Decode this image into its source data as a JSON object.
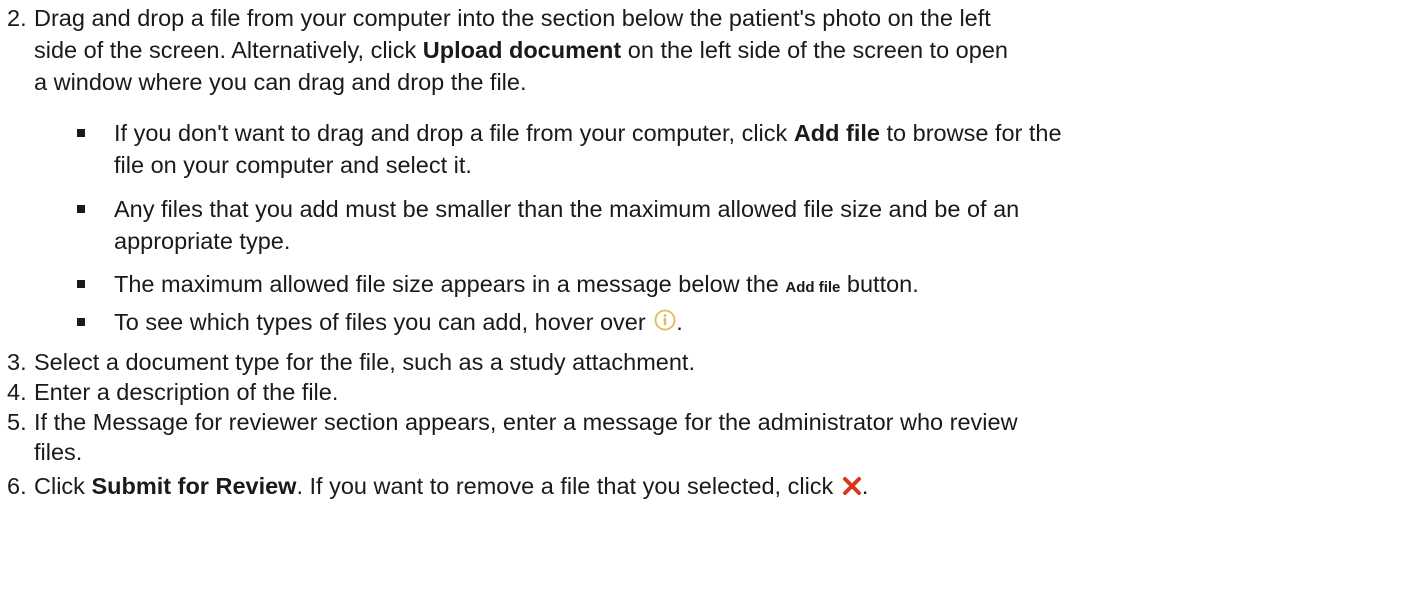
{
  "steps": {
    "s2": {
      "number": "2.",
      "line1": "Drag and drop a file from your computer into the section below the patient's photo on the left",
      "line2_a": "side of the screen. Alternatively, click ",
      "line2_bold": "Upload document",
      "line2_b": " on the left side of the screen to open",
      "line3": "a window where you can drag and drop the file."
    },
    "s3": {
      "number": "3.",
      "text": "Select a document type for the file, such as a study attachment."
    },
    "s4": {
      "number": "4.",
      "text": "Enter a description of the file."
    },
    "s5": {
      "number": "5.",
      "line1": "If the Message for reviewer section appears, enter a message for the administrator who review",
      "line2": "files."
    },
    "s6": {
      "number": "6.",
      "text_a": "Click ",
      "text_bold": "Submit for Review",
      "text_b": ". If you want to remove a file that you selected, click ",
      "text_end": "."
    }
  },
  "bullets": {
    "b1": {
      "line1_a": "If you don't want to drag and drop a file from your computer, click ",
      "line1_bold": "Add file",
      "line1_b": " to browse for the",
      "line2": "file on your computer and select it."
    },
    "b2": {
      "line1": "Any files that you add must be smaller than the maximum allowed file size and be of an",
      "line2": "appropriate type."
    },
    "b3": {
      "text_a": "The maximum allowed file size appears in a message below the ",
      "text_bold": "Add file",
      "text_b": " button."
    },
    "b4": {
      "text_a": "To see which types of files you can add, hover over ",
      "text_end": "."
    }
  },
  "icons": {
    "info": "info-circle-icon",
    "remove": "red-x-icon"
  },
  "colors": {
    "text": "#1a1a1a",
    "info_icon": "#e3b95a",
    "remove_icon": "#d9381e"
  }
}
